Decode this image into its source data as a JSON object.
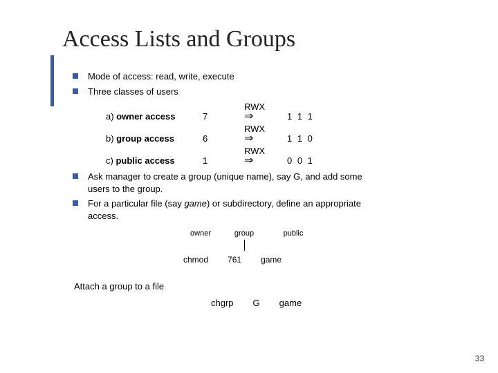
{
  "title": "Access Lists and Groups",
  "bullets": {
    "b1": "Mode of access:  read, write, execute",
    "b2": "Three classes of users",
    "b3a": "Ask manager to create a group (unique name), say G, and add some ",
    "b3b": "users to the group.",
    "b4a": "For a particular file (say ",
    "b4game": "game",
    "b4b": ") or subdirectory, define an appropriate ",
    "b4c": "access."
  },
  "perm": {
    "row1": {
      "labelA": "a) ",
      "labelB": "owner access",
      "num": "7",
      "rwx": "RWX",
      "arrow": "⇒",
      "bits": "1 1 1"
    },
    "row2": {
      "labelA": "b) ",
      "labelB": "group access",
      "num": "6",
      "rwx": "RWX",
      "arrow": "⇒",
      "bits": "1 1 0"
    },
    "row3": {
      "labelA": "c) ",
      "labelB": "public access",
      "num": "1",
      "rwx": "RWX",
      "arrow": "⇒",
      "bits": "0 0 1"
    }
  },
  "labels": {
    "owner": "owner",
    "group": "group",
    "public": "public"
  },
  "cmd": {
    "chmod": "chmod",
    "val": "761",
    "file": "game"
  },
  "attach": "Attach a group to a file",
  "chgrp": {
    "cmd": "chgrp",
    "grp": "G",
    "file": "game"
  },
  "pagenum": "33"
}
